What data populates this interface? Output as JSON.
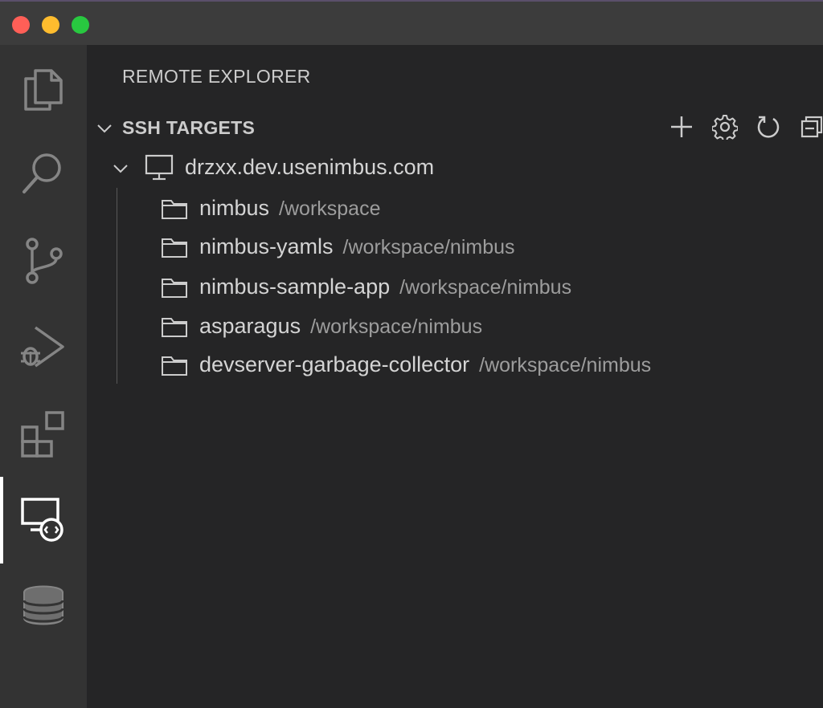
{
  "sidebar": {
    "title": "REMOTE EXPLORER"
  },
  "section": {
    "label": "SSH TARGETS",
    "actions": [
      "add-icon",
      "gear-icon",
      "refresh-icon",
      "collapse-all-icon"
    ]
  },
  "host": {
    "name": "drzxx.dev.usenimbus.com"
  },
  "folders": [
    {
      "name": "nimbus",
      "path": "/workspace"
    },
    {
      "name": "nimbus-yamls",
      "path": "/workspace/nimbus"
    },
    {
      "name": "nimbus-sample-app",
      "path": "/workspace/nimbus"
    },
    {
      "name": "asparagus",
      "path": "/workspace/nimbus"
    },
    {
      "name": "devserver-garbage-collector",
      "path": "/workspace/nimbus"
    }
  ],
  "activitybar": {
    "items": [
      "explorer-icon",
      "search-icon",
      "source-control-icon",
      "run-debug-icon",
      "extensions-icon",
      "remote-explorer-icon",
      "database-icon"
    ],
    "active": "remote-explorer-icon"
  },
  "colors": {
    "titlebar": "#3c3c3c",
    "activitybar": "#333333",
    "sidebar": "#252526",
    "text": "#d4d4d4",
    "muted": "#9d9d9d",
    "close": "#ff5f57",
    "minimize": "#febc2e",
    "zoom": "#28c840"
  }
}
